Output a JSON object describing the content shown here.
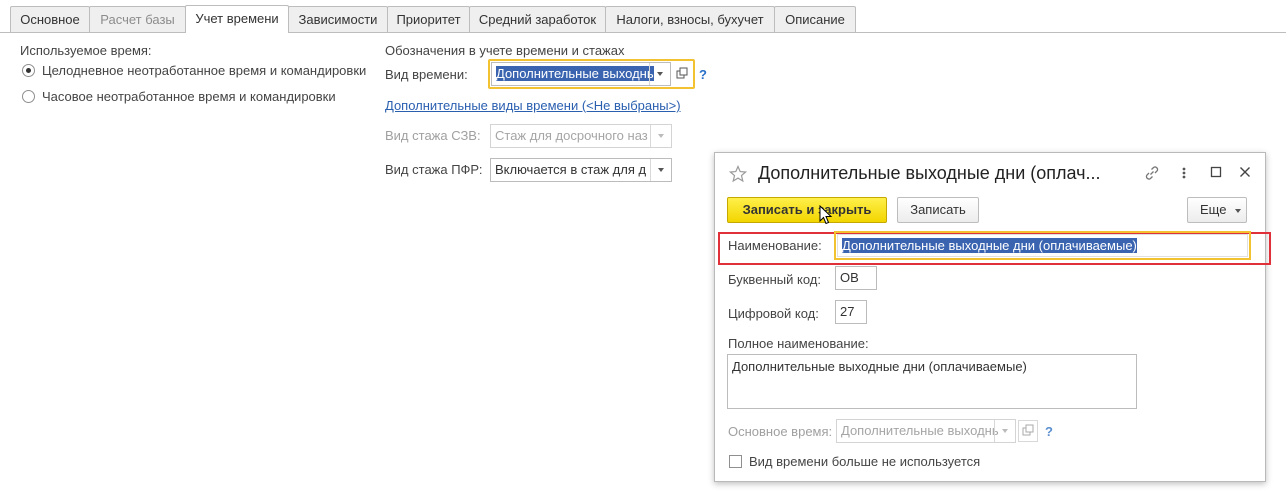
{
  "tabs": [
    {
      "label": "Основное",
      "state": "normal"
    },
    {
      "label": "Расчет базы",
      "state": "disabled"
    },
    {
      "label": "Учет времени",
      "state": "active"
    },
    {
      "label": "Зависимости",
      "state": "normal"
    },
    {
      "label": "Приоритет",
      "state": "normal"
    },
    {
      "label": "Средний заработок",
      "state": "normal"
    },
    {
      "label": "Налоги, взносы, бухучет",
      "state": "normal"
    },
    {
      "label": "Описание",
      "state": "normal"
    }
  ],
  "left": {
    "section_title": "Используемое время:",
    "option_full_day": "Целодневное неотработанное время и командировки",
    "option_hourly": "Часовое неотработанное время и командировки",
    "selected": "option_full_day"
  },
  "right": {
    "section_title": "Обозначения в учете времени и стажах",
    "time_type_label": "Вид времени:",
    "time_type_value": "Дополнительные выходнь",
    "help": "?",
    "extra_types_link": "Дополнительные виды времени (<Не выбраны>)",
    "szv_label": "Вид стажа СЗВ:",
    "szv_value": "Стаж для досрочного наз",
    "pfr_label": "Вид стажа ПФР:",
    "pfr_value": "Включается в стаж для д"
  },
  "dialog": {
    "title": "Дополнительные выходные дни (оплач...",
    "save_close": "Записать и закрыть",
    "save": "Записать",
    "more": "Еще",
    "name_label": "Наименование:",
    "name_value": "Дополнительные выходные дни (оплачиваемые)",
    "letter_code_label": "Буквенный код:",
    "letter_code_value": "ОВ",
    "digit_code_label": "Цифровой код:",
    "digit_code_value": "27",
    "full_name_label": "Полное наименование:",
    "full_name_value": "Дополнительные выходные дни (оплачиваемые)",
    "base_time_label": "Основное время:",
    "base_time_value": "Дополнительные выходнь",
    "help": "?",
    "not_used_label": "Вид времени больше не используется"
  },
  "colors": {
    "accent_green": "#3c9a35",
    "highlight_yellow": "#f2c230",
    "highlight_red": "#e0303a",
    "selection_blue": "#3a64b0",
    "primary_button": "#f2d500"
  }
}
